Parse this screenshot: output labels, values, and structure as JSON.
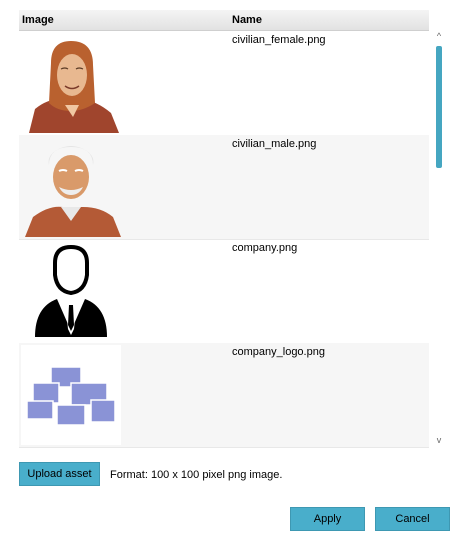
{
  "table": {
    "headers": {
      "image": "Image",
      "name": "Name"
    },
    "rows": [
      {
        "name": "civilian_female.png",
        "icon": "woman-with-headscarf-portrait"
      },
      {
        "name": "civilian_male.png",
        "icon": "old-man-portrait"
      },
      {
        "name": "company.png",
        "icon": "businessman-silhouette-icon"
      },
      {
        "name": "company_logo.png",
        "icon": "stacked-rectangles-logo"
      }
    ]
  },
  "upload": {
    "button_label": "Upload asset",
    "format_text": "Format: 100 x 100 pixel png image."
  },
  "dialog": {
    "apply_label": "Apply",
    "cancel_label": "Cancel"
  },
  "scrollbar": {
    "up": "^",
    "down": "v"
  },
  "colors": {
    "accent": "#49aecb",
    "header_bg": "#e6e6e6"
  }
}
